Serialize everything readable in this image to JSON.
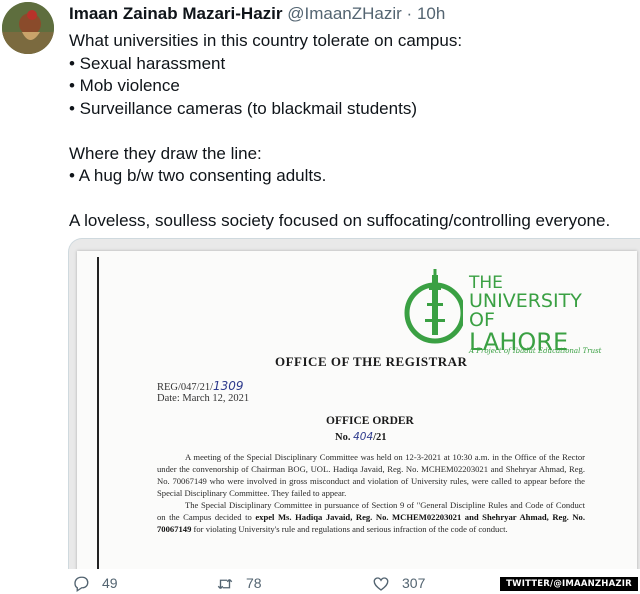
{
  "tweet": {
    "author_name": "Imaan Zainab Mazari-Hazir",
    "handle": "@ImaanZHazir",
    "separator": "·",
    "time": "10h",
    "lines": [
      "What universities in this country tolerate on campus:",
      "• Sexual harassment",
      "• Mob violence",
      "• Surveillance cameras (to blackmail students)",
      "",
      "Where they draw the line:",
      "• A hug b/w two consenting adults.",
      "",
      "A loveless, soulless society focused on suffocating/controlling everyone."
    ]
  },
  "document": {
    "logo": {
      "line1": "THE",
      "line2": "UNIVERSITY OF",
      "line3": "LAHORE",
      "tagline": "A Project of Ibadat Educational Trust"
    },
    "office": "OFFICE OF THE REGISTRAR",
    "ref_prefix": "REG/047/21/",
    "ref_hand": "1309",
    "date": "Date: March 12, 2021",
    "order_title": "OFFICE ORDER",
    "order_no_prefix": "No. ",
    "order_no_hand": "404",
    "order_no_suffix": "/21",
    "paragraph1": "A meeting of the Special Disciplinary Committee was held on 12-3-2021 at 10:30 a.m. in the Office of the Rector under the convenorship of Chairman BOG, UOL. Hadiqa Javaid, Reg. No. MCHEM02203021 and Shehryar Ahmad, Reg. No. 70067149 who were involved in gross misconduct and violation of University rules, were called to appear before the Special Disciplinary Committee. They failed to appear.",
    "paragraph2_start": "The Special Disciplinary Committee in pursuance of Section 9 of \"General Discipline Rules and Code of Conduct on the Campus decided to ",
    "paragraph2_bold": "expel Ms. Hadiqa Javaid, Reg. No. MCHEM02203021 and Shehryar Ahmad, Reg. No. 70067149",
    "paragraph2_end": " for violating University's rule and regulations and serious infraction of the code of conduct."
  },
  "actions": {
    "replies": "49",
    "retweets": "78",
    "likes": "307"
  },
  "watermark": "TWITTER/@IMAANZHAZIR",
  "colors": {
    "text": "#0f1419",
    "muted": "#536471",
    "logo_green": "#3aa043",
    "ink_blue": "#2d3a8c"
  },
  "icons": [
    "reply-icon",
    "retweet-icon",
    "like-icon"
  ]
}
